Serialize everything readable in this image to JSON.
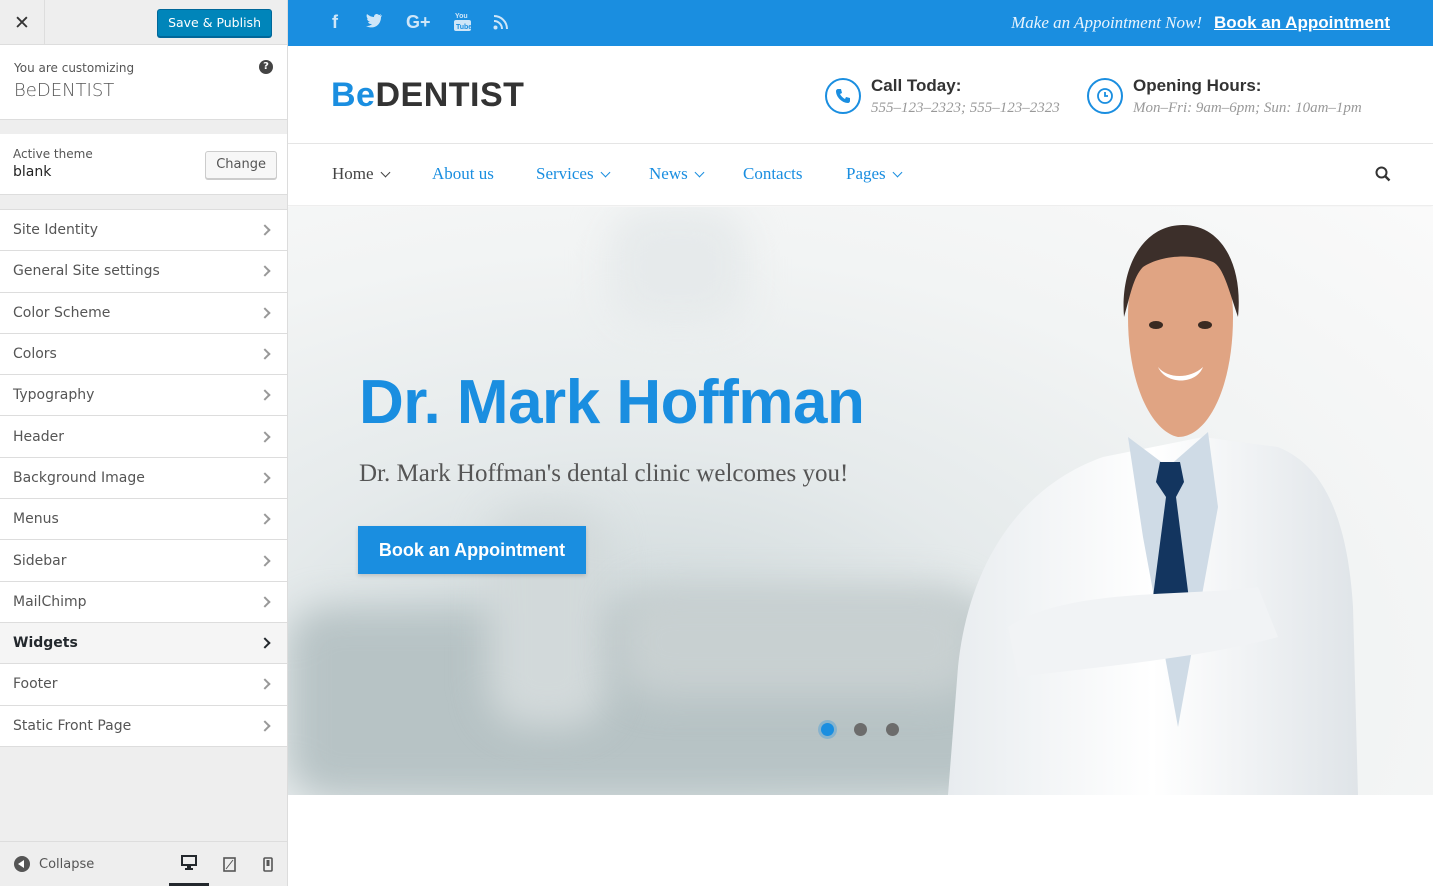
{
  "sidebar": {
    "save_label": "Save & Publish",
    "customizing_label": "You are customizing",
    "site_name": "BeDENTIST",
    "active_theme_label": "Active theme",
    "theme_name": "blank",
    "change_label": "Change",
    "sections": [
      {
        "label": "Site Identity"
      },
      {
        "label": "General Site settings"
      },
      {
        "label": "Color Scheme"
      },
      {
        "label": "Colors"
      },
      {
        "label": "Typography"
      },
      {
        "label": "Header"
      },
      {
        "label": "Background Image"
      },
      {
        "label": "Menus"
      },
      {
        "label": "Sidebar"
      },
      {
        "label": "MailChimp"
      },
      {
        "label": "Widgets",
        "highlighted": true
      },
      {
        "label": "Footer"
      },
      {
        "label": "Static Front Page"
      }
    ],
    "collapse_label": "Collapse"
  },
  "preview": {
    "topbar": {
      "social_icons": [
        "facebook-icon",
        "twitter-icon",
        "google-plus-icon",
        "youtube-icon",
        "rss-icon"
      ],
      "cta_text": "Make an Appointment Now!",
      "cta_link": "Book an Appointment"
    },
    "logo": {
      "prefix": "Be",
      "main": "DENTIST"
    },
    "call": {
      "title": "Call Today:",
      "text": "555–123–2323; 555–123–2323"
    },
    "hours": {
      "title": "Opening Hours:",
      "text": "Mon–Fri: 9am–6pm; Sun: 10am–1pm"
    },
    "nav": [
      {
        "label": "Home"
      },
      {
        "label": "About us"
      },
      {
        "label": "Services"
      },
      {
        "label": "News"
      },
      {
        "label": "Contacts"
      },
      {
        "label": "Pages"
      }
    ],
    "hero": {
      "title": "Dr. Mark Hoffman",
      "subtitle": "Dr. Mark Hoffman's dental clinic welcomes you!",
      "button": "Book an Appointment"
    },
    "accent_color": "#1a8ee0"
  }
}
